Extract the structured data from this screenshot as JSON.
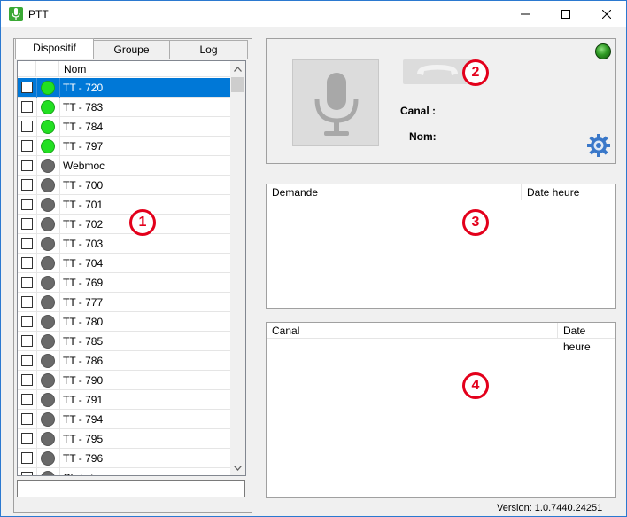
{
  "window": {
    "title": "PTT",
    "minimize_icon": "minimize-icon",
    "maximize_icon": "maximize-icon",
    "close_icon": "close-icon"
  },
  "tabs": [
    {
      "label": "Dispositif",
      "active": true
    },
    {
      "label": "Groupe",
      "active": false
    },
    {
      "label": "Log",
      "active": false
    }
  ],
  "device_list": {
    "header": {
      "col_check": "",
      "col_status": "",
      "col_name": "Nom"
    },
    "rows": [
      {
        "name": "TT - 720",
        "status": "online",
        "selected": true
      },
      {
        "name": "TT - 783",
        "status": "online",
        "selected": false
      },
      {
        "name": "TT - 784",
        "status": "online",
        "selected": false
      },
      {
        "name": "TT - 797",
        "status": "online",
        "selected": false
      },
      {
        "name": "Webmoc",
        "status": "offline",
        "selected": false
      },
      {
        "name": "TT - 700",
        "status": "offline",
        "selected": false
      },
      {
        "name": "TT - 701",
        "status": "offline",
        "selected": false
      },
      {
        "name": "TT - 702",
        "status": "offline",
        "selected": false
      },
      {
        "name": "TT - 703",
        "status": "offline",
        "selected": false
      },
      {
        "name": "TT - 704",
        "status": "offline",
        "selected": false
      },
      {
        "name": "TT - 769",
        "status": "offline",
        "selected": false
      },
      {
        "name": "TT - 777",
        "status": "offline",
        "selected": false
      },
      {
        "name": "TT - 780",
        "status": "offline",
        "selected": false
      },
      {
        "name": "TT - 785",
        "status": "offline",
        "selected": false
      },
      {
        "name": "TT - 786",
        "status": "offline",
        "selected": false
      },
      {
        "name": "TT - 790",
        "status": "offline",
        "selected": false
      },
      {
        "name": "TT - 791",
        "status": "offline",
        "selected": false
      },
      {
        "name": "TT - 794",
        "status": "offline",
        "selected": false
      },
      {
        "name": "TT - 795",
        "status": "offline",
        "selected": false
      },
      {
        "name": "TT - 796",
        "status": "offline",
        "selected": false
      },
      {
        "name": "Christine",
        "status": "offline",
        "selected": false
      }
    ],
    "status_colors": {
      "online": "#22e022",
      "offline": "#696969"
    }
  },
  "bottom_input": {
    "value": ""
  },
  "ptt_panel": {
    "canal_label": "Canal :",
    "canal_value": "",
    "nom_label": "Nom:",
    "nom_value": "",
    "mic_icon": "microphone-icon",
    "phone_icon": "phone-icon",
    "status_led": "status-led-icon",
    "settings_icon": "gear-icon"
  },
  "requests_grid": {
    "col1": "Demande",
    "col2": "Date heure"
  },
  "channels_grid": {
    "col1": "Canal",
    "col2": "Date heure"
  },
  "markers": [
    "1",
    "2",
    "3",
    "4"
  ],
  "version": "Version: 1.0.7440.24251"
}
